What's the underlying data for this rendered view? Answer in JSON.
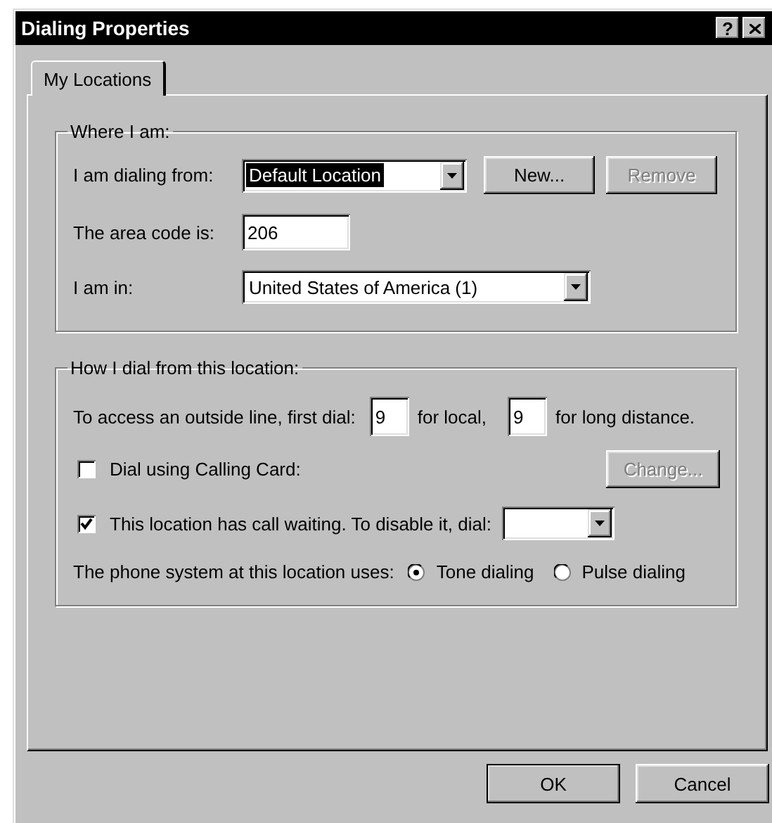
{
  "window": {
    "title": "Dialing Properties",
    "help_label": "?"
  },
  "tabs": [
    {
      "label": "My Locations",
      "selected": true
    }
  ],
  "where_i_am": {
    "legend": "Where I am:",
    "dialing_from": {
      "label": "I am dialing from:",
      "value": "Default Location",
      "highlighted": true
    },
    "new_button": {
      "label": "New...",
      "disabled": false
    },
    "remove_button": {
      "label": "Remove",
      "disabled": true
    },
    "area_code": {
      "label": "The area code is:",
      "value": "206"
    },
    "country": {
      "label": "I am in:",
      "value": "United States of America (1)"
    }
  },
  "how_i_dial": {
    "legend": "How I dial from this location:",
    "outside_line": {
      "label": "To access an outside line, first dial:",
      "local_value": "9",
      "local_label": "for local,",
      "long_value": "9",
      "long_label": "for long distance."
    },
    "calling_card": {
      "label": "Dial using Calling Card:",
      "checked": false
    },
    "change_button": {
      "label": "Change...",
      "disabled": true
    },
    "call_waiting": {
      "label": "This location has call waiting. To disable it, dial:",
      "checked": true
    },
    "phone_system": {
      "label": "The phone system at this location uses:",
      "options": [
        {
          "label": "Tone dialing",
          "selected": true
        },
        {
          "label": "Pulse dialing",
          "selected": false
        }
      ]
    }
  },
  "buttons": [
    {
      "label": "OK"
    },
    {
      "label": "Cancel"
    }
  ]
}
